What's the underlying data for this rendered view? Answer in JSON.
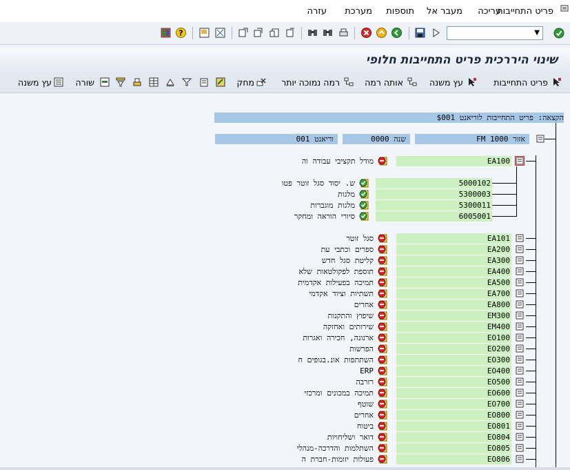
{
  "menu": {
    "items": [
      "פריט התחייבות",
      "עריכה",
      "מעבר אל",
      "תוספות",
      "מערכת",
      "עזרה"
    ]
  },
  "toolbar": {
    "command_value": "",
    "enter_icon": "check-icon"
  },
  "title": "שינוי היררכית פריט התחייבות חלופי",
  "app_toolbar": {
    "buttons": [
      "פריט התחייבות",
      "עץ משנה",
      "אותה רמה",
      "רמה נמוכה יותר",
      "מחק",
      "שורה",
      "עץ משנה"
    ]
  },
  "tree": {
    "header_label": "הקצאה: פריט התחייבות לוריאנט $001",
    "area_label": "אזור 1000 FM",
    "year_label": "שנה 0000",
    "variant_label": "וריאנט 001",
    "root": {
      "code": "EA100",
      "desc": "מודל תקציבי עבודה וה"
    },
    "children": [
      {
        "code": "5000102",
        "desc": "ש. יסוד סגל זוטר פטו"
      },
      {
        "code": "5300003",
        "desc": "מלגות"
      },
      {
        "code": "5300011",
        "desc": "מלגות מוגברות"
      },
      {
        "code": "6005001",
        "desc": "סיורי הוראה ומחקר"
      }
    ],
    "nodes": [
      {
        "code": "EA101",
        "desc": "סגל זוטר"
      },
      {
        "code": "EA200",
        "desc": "ספרים וכתבי עת"
      },
      {
        "code": "EA300",
        "desc": "קליטת סגל חדש"
      },
      {
        "code": "EA400",
        "desc": "תוספת לפקולטאות שלא"
      },
      {
        "code": "EA500",
        "desc": "תמיכה בפעילות אקדמית"
      },
      {
        "code": "EA700",
        "desc": "תשתיות וציוד אקדמי"
      },
      {
        "code": "EA800",
        "desc": "אחרים"
      },
      {
        "code": "EM300",
        "desc": "שיפוץ והתקנות"
      },
      {
        "code": "EM400",
        "desc": "שירותים ואחזקה"
      },
      {
        "code": "EO100",
        "desc": "ארנונה, חכירה ואגרות"
      },
      {
        "code": "EO200",
        "desc": "הפרשות"
      },
      {
        "code": "EO300",
        "desc": "השתתפות אונ.בגופים ח"
      },
      {
        "code": "EO400",
        "desc": "ERP"
      },
      {
        "code": "EO500",
        "desc": "רזרבה"
      },
      {
        "code": "EO600",
        "desc": "תמיכה במכונים ומרכזי"
      },
      {
        "code": "EO700",
        "desc": "שוטף"
      },
      {
        "code": "EO800",
        "desc": "אחרים"
      },
      {
        "code": "EO801",
        "desc": "ביטוח"
      },
      {
        "code": "EO804",
        "desc": "דואר ושליחויות"
      },
      {
        "code": "EO805",
        "desc": "השתלמות והדרכה-מנהלי"
      },
      {
        "code": "EO806",
        "desc": "פעולות יזומות-חברת ה"
      }
    ]
  },
  "colors": {
    "header_blue": "#a7c7e7",
    "code_green": "#ccf0c0",
    "status_red": "#d42a2a",
    "status_green": "#3da33d"
  }
}
